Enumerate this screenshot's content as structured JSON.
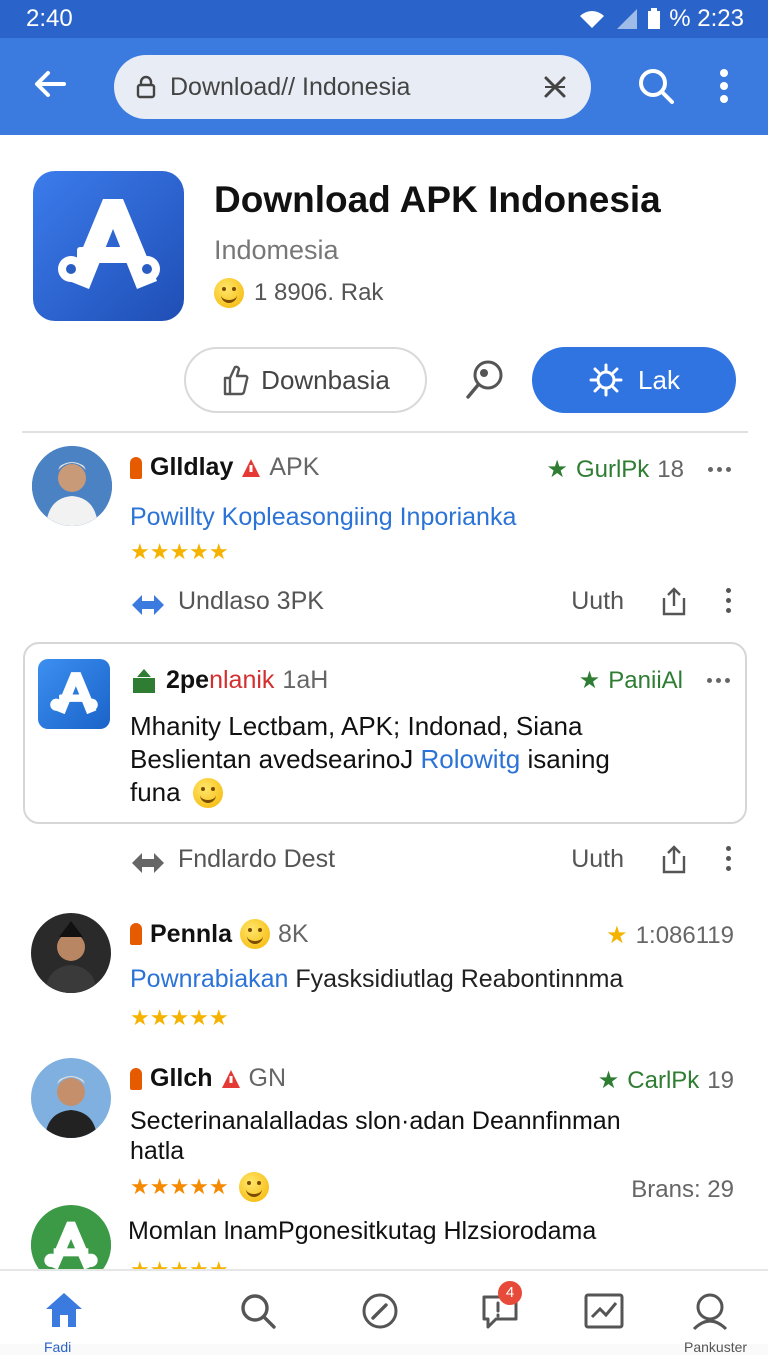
{
  "status_bar": {
    "time": "2:40",
    "right_text": "% 2:23"
  },
  "address_bar": {
    "url": "Download// Indonesia"
  },
  "app": {
    "title": "Download APK Indonesia",
    "country": "Indomesia",
    "stats": "1 8906. Rak",
    "download_button": "Downbasia",
    "primary_button": "Lak"
  },
  "posts": [
    {
      "name": "Glldlay",
      "tag": "APK",
      "meta_label": "GurlPk",
      "meta_count": "18",
      "title": "Powillty Kopleasongiing Inporianka",
      "stars": "★★★★★",
      "action_label": "Undlaso 3PK",
      "action_right": "Uuth"
    },
    {
      "name": "2pe",
      "name_red": "nlanik",
      "tag": "1aH",
      "meta_label": "PaniiAl",
      "body_line1": "Mhanity Lectbam, APK; Indonad, Siana",
      "body_line2a": "Beslientan avedsearinoJ ",
      "body_line2b": "Rolowitg",
      "body_line2c": " isaning",
      "body_line3": "funa",
      "action_label": "Fndlardo Dest",
      "action_right": "Uuth"
    },
    {
      "name": "Pennla",
      "tag": "8K",
      "meta_label": "1:086119",
      "title_blue": "Pownrabiakan",
      "title_dark": " Fyasksidiutlag Reabontinnma",
      "stars": "★★★★★"
    },
    {
      "name": "Gllch",
      "tag": "GN",
      "meta_label": "CarlPk",
      "meta_count": "19",
      "body_line1": "Secterinanalalladas slon·adan Deannfinman",
      "body_line2": "hatla",
      "stars": "★★★★★",
      "brans": "Brans: 29"
    },
    {
      "body_line1": "Momlan lnamPgonesitkutag Hlzsiorodama",
      "stars": "★★★★★"
    }
  ],
  "bottom_nav": {
    "home_label": "Fadi",
    "chat_badge": "4",
    "profile_label": "Pankuster"
  },
  "colors": {
    "app_bar": "#3b7be0",
    "accent": "#2f74e0",
    "green": "#2e7d32",
    "star": "#f5b300"
  }
}
